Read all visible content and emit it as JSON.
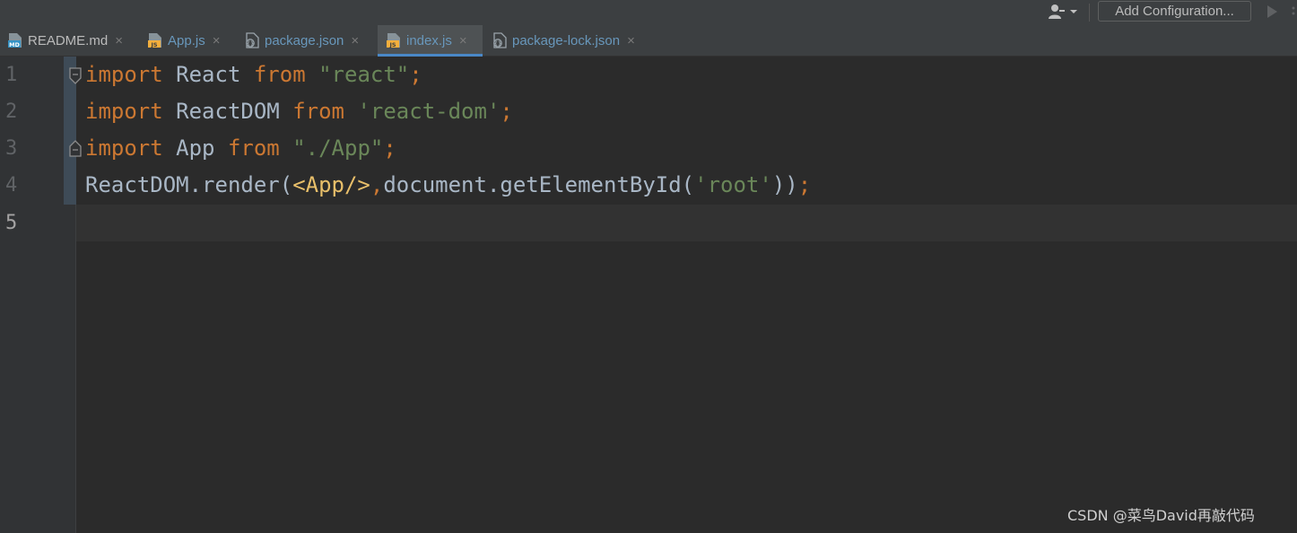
{
  "toolbar": {
    "user_icon": "user-icon",
    "add_configuration": "Add Configuration...",
    "run_icon": "play-icon"
  },
  "tabs": [
    {
      "label": "README.md",
      "icon": "markdown-file-icon",
      "icon_text": "MD",
      "color": "#bbbbbb",
      "active": false
    },
    {
      "label": "App.js",
      "icon": "js-file-icon",
      "icon_text": "JS",
      "color": "#6897bb",
      "active": false
    },
    {
      "label": "package.json",
      "icon": "json-file-icon",
      "icon_text": "{}",
      "color": "#6897bb",
      "active": false
    },
    {
      "label": "index.js",
      "icon": "js-file-icon",
      "icon_text": "JS",
      "color": "#6897bb",
      "active": true
    },
    {
      "label": "package-lock.json",
      "icon": "json-file-icon",
      "icon_text": "{}",
      "color": "#6897bb",
      "active": false
    }
  ],
  "tab_close_glyph": "×",
  "editor": {
    "current_line": 5,
    "line_numbers": [
      "1",
      "2",
      "3",
      "4",
      "5"
    ],
    "lines": [
      {
        "tokens": [
          {
            "t": "import",
            "k": "kw"
          },
          {
            "t": " React ",
            "k": "plain"
          },
          {
            "t": "from",
            "k": "kw"
          },
          {
            "t": " ",
            "k": "plain"
          },
          {
            "t": "\"react\"",
            "k": "str"
          },
          {
            "t": ";",
            "k": "kw"
          }
        ]
      },
      {
        "tokens": [
          {
            "t": "import",
            "k": "kw"
          },
          {
            "t": " ReactDOM ",
            "k": "plain"
          },
          {
            "t": "from",
            "k": "kw"
          },
          {
            "t": " ",
            "k": "plain"
          },
          {
            "t": "'react-dom'",
            "k": "str"
          },
          {
            "t": ";",
            "k": "kw"
          }
        ]
      },
      {
        "tokens": [
          {
            "t": "import",
            "k": "kw"
          },
          {
            "t": " App ",
            "k": "plain"
          },
          {
            "t": "from",
            "k": "kw"
          },
          {
            "t": " ",
            "k": "plain"
          },
          {
            "t": "\"./App\"",
            "k": "str"
          },
          {
            "t": ";",
            "k": "kw"
          }
        ]
      },
      {
        "tokens": [
          {
            "t": "ReactDOM.render(",
            "k": "plain"
          },
          {
            "t": "<App/>",
            "k": "tag"
          },
          {
            "t": ",",
            "k": "kw"
          },
          {
            "t": "document.getElementById(",
            "k": "plain"
          },
          {
            "t": "'root'",
            "k": "str"
          },
          {
            "t": "))",
            "k": "plain"
          },
          {
            "t": ";",
            "k": "kw"
          }
        ]
      },
      {
        "tokens": []
      }
    ]
  },
  "colors": {
    "keyword": "#cc7832",
    "string": "#6a8759",
    "tag": "#e8bf6a",
    "plain": "#a9b7c6",
    "active_tab_underline": "#4a88c7"
  },
  "watermark": "CSDN @菜鸟David再敲代码"
}
